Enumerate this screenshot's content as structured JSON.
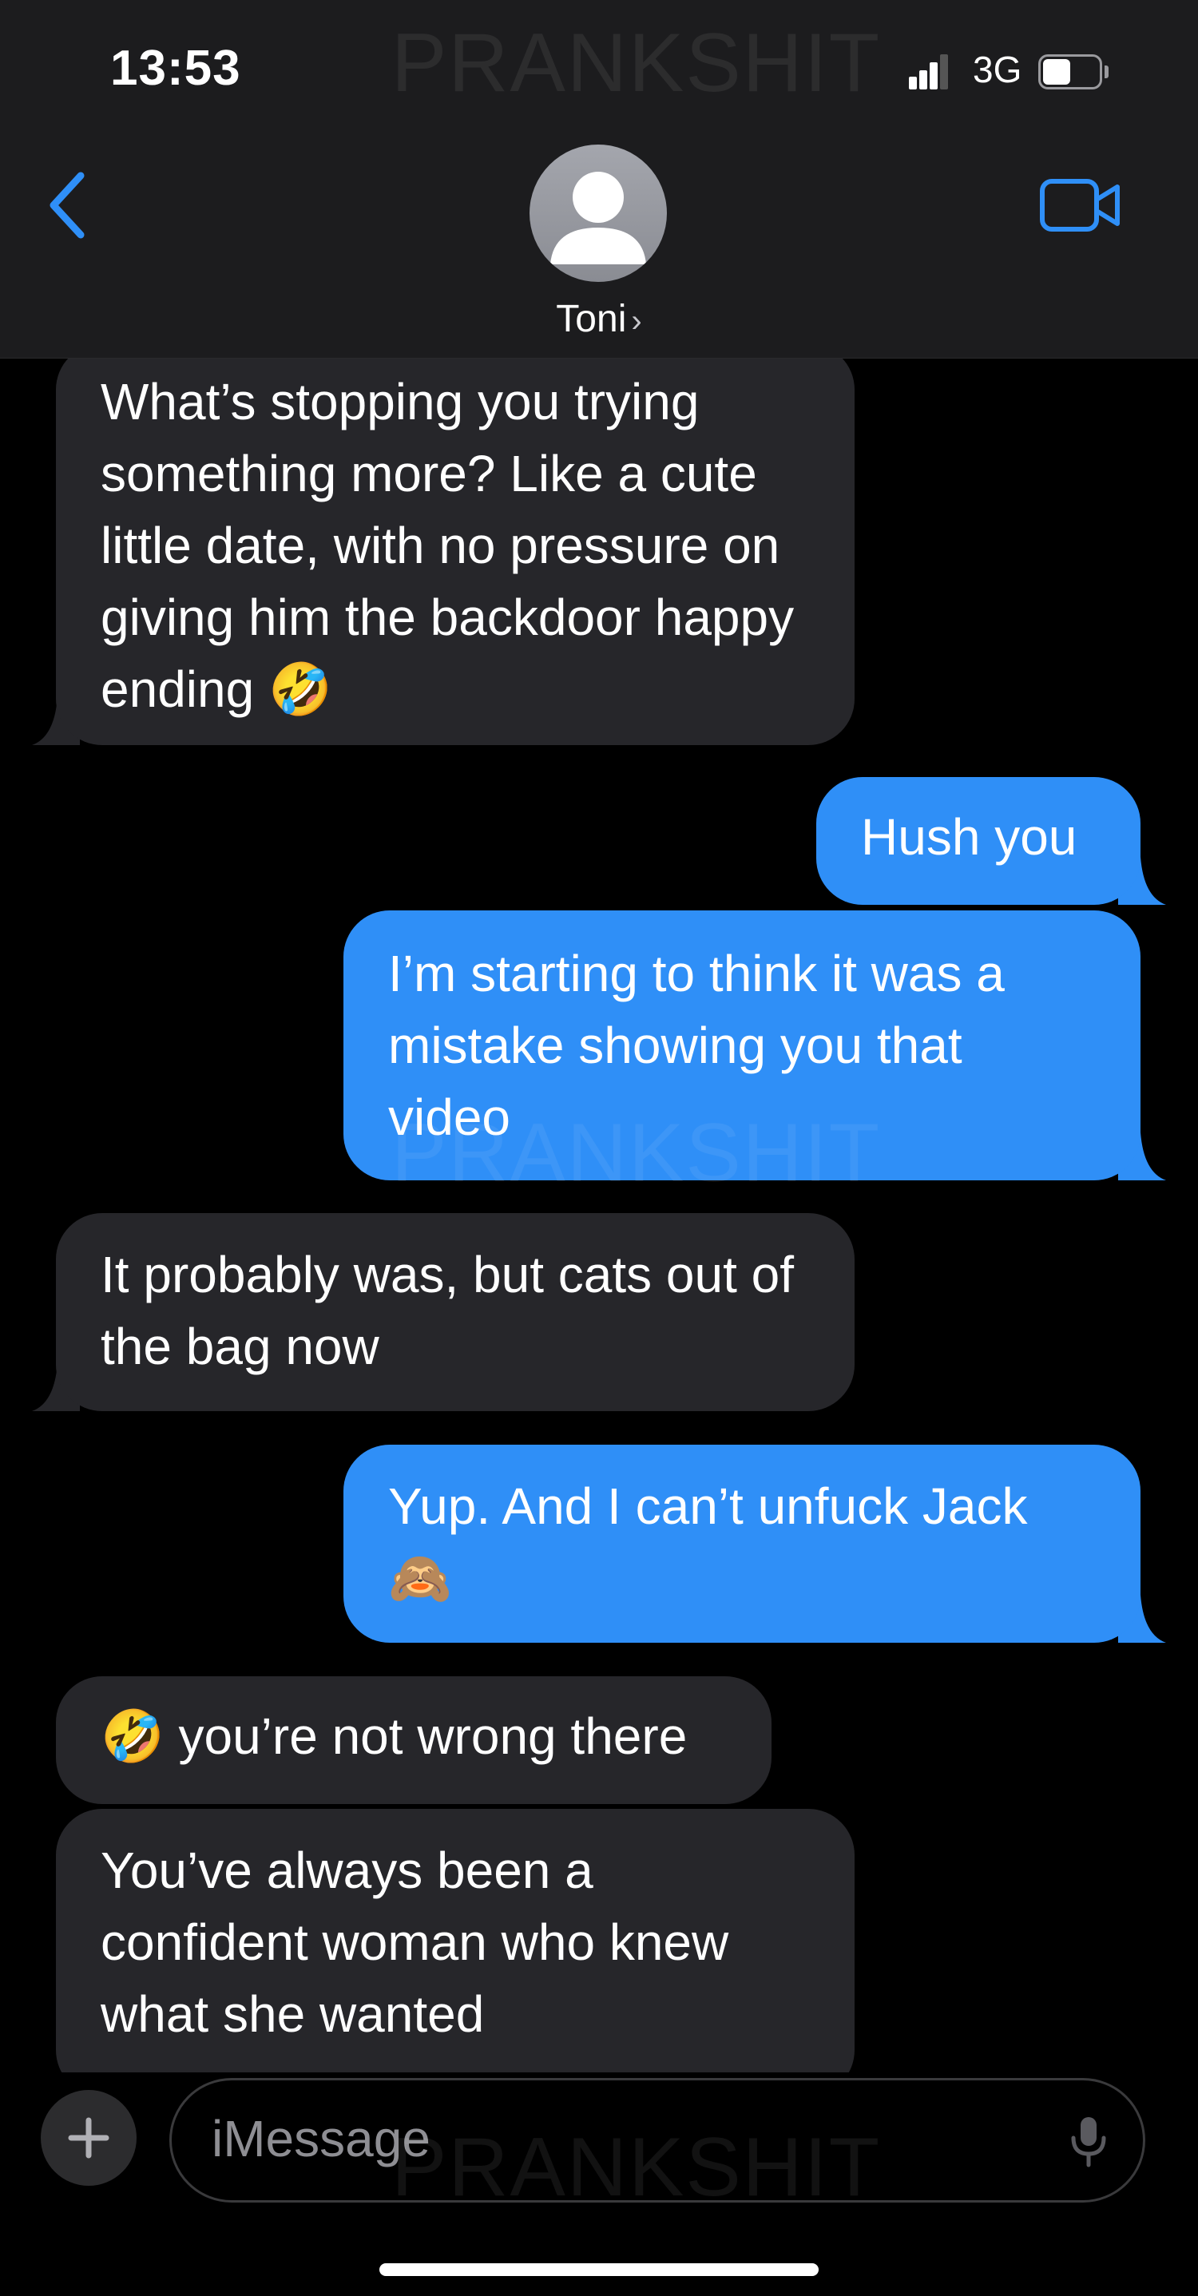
{
  "status_bar": {
    "time": "13:53",
    "network": "3G"
  },
  "header": {
    "contact_name": "Toni",
    "contact_chevron": "›",
    "icons": {
      "back": "chevron-left-icon",
      "video": "video-camera-icon",
      "avatar": "person-silhouette"
    }
  },
  "watermark": "PRANKSHIT",
  "messages": [
    {
      "direction": "incoming",
      "text": "What’s stopping you trying something more? Like a cute little date, with no pressure on giving him the backdoor happy ending 🤣"
    },
    {
      "direction": "outgoing",
      "text": "Hush you"
    },
    {
      "direction": "outgoing",
      "text": "I’m starting to think it was a mistake showing you that video"
    },
    {
      "direction": "incoming",
      "text": "It probably was, but cats out of the bag now"
    },
    {
      "direction": "outgoing",
      "text": "Yup. And I can’t unfuck Jack 🙈"
    },
    {
      "direction": "incoming",
      "text": "🤣 you’re not wrong there"
    },
    {
      "direction": "incoming",
      "text": "You’ve always been a confident woman who knew what she wanted"
    }
  ],
  "composer": {
    "placeholder": "iMessage",
    "plus_label": "+"
  },
  "colors": {
    "incoming_bubble": "#26262a",
    "outgoing_bubble": "#2f8ff7",
    "accent": "#2f8ff7",
    "header_bg": "#1c1c1e"
  }
}
